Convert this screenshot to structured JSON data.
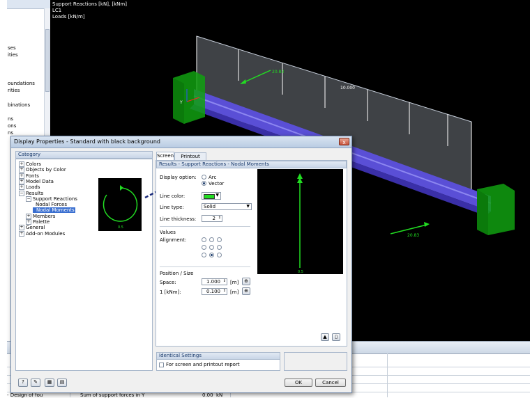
{
  "left_panel": {
    "items": [
      "ses",
      "ities",
      "oundations",
      "rities",
      "binations",
      "ns",
      "ons",
      "ns",
      "- Design of fou"
    ]
  },
  "viewport": {
    "info_lines": [
      "Support Reactions [kN], [kNm]",
      "LC1",
      "Loads [kN/m]"
    ],
    "load_label": "10.000",
    "reaction_label_1": "20.83",
    "reaction_label_2": "20.83",
    "axis_label": "Y"
  },
  "bottom_table": {
    "row_text": "Sum of support forces in Y",
    "row_value": "0.00",
    "row_unit": "kN"
  },
  "dialog": {
    "title": "Display Properties - Standard with black background",
    "close_label": "x",
    "category_header": "Category",
    "tree": [
      {
        "label": "Colors",
        "exp": "+",
        "level": 0
      },
      {
        "label": "Objects by Color",
        "exp": "+",
        "level": 0
      },
      {
        "label": "Fonts",
        "exp": "+",
        "level": 0
      },
      {
        "label": "Model Data",
        "exp": "+",
        "level": 0
      },
      {
        "label": "Loads",
        "exp": "+",
        "level": 0
      },
      {
        "label": "Results",
        "exp": "−",
        "level": 0
      },
      {
        "label": "Support Reactions",
        "exp": "−",
        "level": 1
      },
      {
        "label": "Nodal Forces",
        "exp": "",
        "level": 2
      },
      {
        "label": "Nodal Moments",
        "exp": "",
        "level": 2,
        "selected": true
      },
      {
        "label": "Members",
        "exp": "+",
        "level": 1
      },
      {
        "label": "Palette",
        "exp": "+",
        "level": 1
      },
      {
        "label": "General",
        "exp": "+",
        "level": 0
      },
      {
        "label": "Add-on Modules",
        "exp": "+",
        "level": 0
      }
    ],
    "tabs": [
      "Screen",
      "Printout Report"
    ],
    "section_header": "Results - Support Reactions - Nodal Moments",
    "display_option_label": "Display option:",
    "option_arc": "Arc",
    "option_vector": "Vector",
    "line_color_label": "Line color:",
    "line_color": "#22dd22",
    "line_type_label": "Line type:",
    "line_type_value": "Solid",
    "line_thickness_label": "Line thickness:",
    "line_thickness_value": "2",
    "values_label": "Values",
    "alignment_label": "Alignment:",
    "alignment_selected_index": 7,
    "position_size_label": "Position / Size",
    "space_label": "Space:",
    "space_value": "1.000",
    "space_unit": "[m]",
    "scale_label": "1  [kNm]:",
    "scale_value": "0.100",
    "scale_unit": "[m]",
    "preview_value": "0.5",
    "preview_arc_value": "0.5",
    "identical_header": "Identical Settings",
    "identical_checkbox": "For screen and printout report",
    "ok_label": "OK",
    "cancel_label": "Cancel"
  }
}
